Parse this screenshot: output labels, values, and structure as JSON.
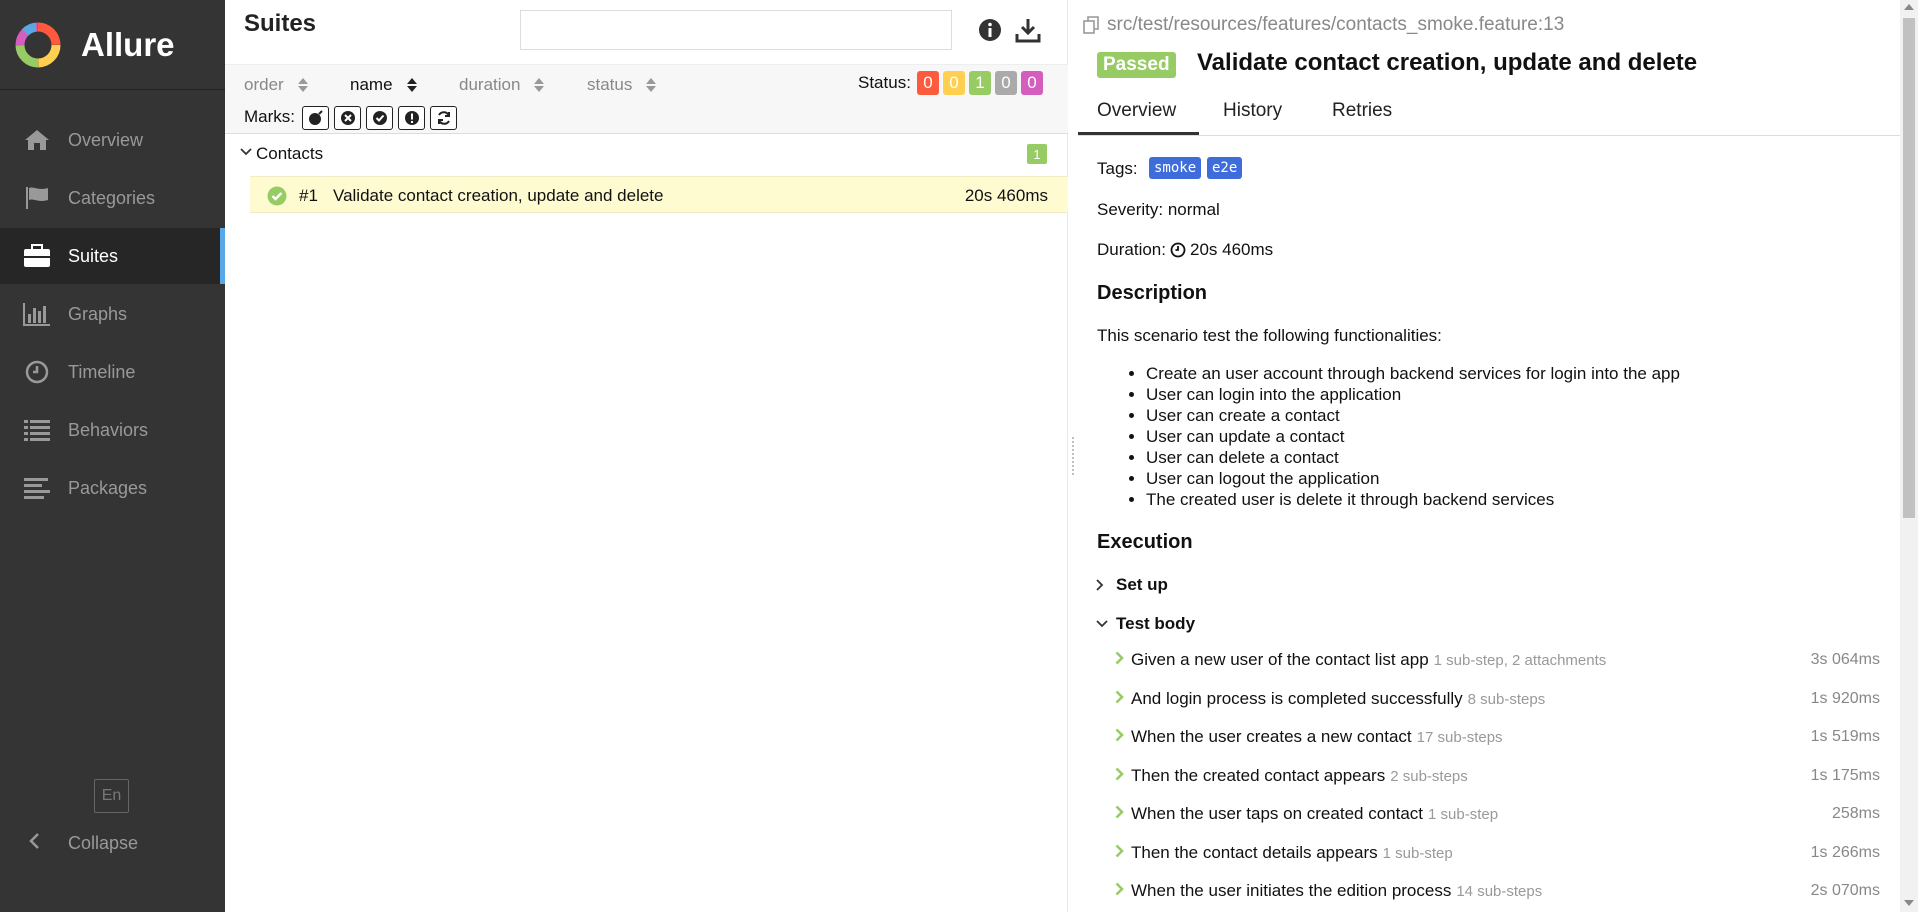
{
  "app": {
    "name": "Allure"
  },
  "sidebar": {
    "items": [
      {
        "label": "Overview",
        "icon": "home-icon"
      },
      {
        "label": "Categories",
        "icon": "flag-icon"
      },
      {
        "label": "Suites",
        "icon": "briefcase-icon",
        "active": true
      },
      {
        "label": "Graphs",
        "icon": "bar-chart-icon"
      },
      {
        "label": "Timeline",
        "icon": "clock-icon"
      },
      {
        "label": "Behaviors",
        "icon": "list-icon"
      },
      {
        "label": "Packages",
        "icon": "align-left-icon"
      }
    ],
    "language": "En",
    "collapse_label": "Collapse"
  },
  "suites": {
    "title": "Suites",
    "search": {
      "value": "",
      "placeholder": ""
    },
    "sorters": [
      "order",
      "name",
      "duration",
      "status"
    ],
    "active_sorter": "name",
    "status_label": "Status:",
    "status_counts": [
      {
        "value": "0",
        "color": "#fd5a3e"
      },
      {
        "value": "0",
        "color": "#ffd050"
      },
      {
        "value": "1",
        "color": "#97cc64"
      },
      {
        "value": "0",
        "color": "#aaaaaa"
      },
      {
        "value": "0",
        "color": "#d35ebe"
      }
    ],
    "marks_label": "Marks:",
    "group": {
      "name": "Contacts",
      "count": "1"
    },
    "test": {
      "order": "#1",
      "name": "Validate contact creation, update and delete",
      "duration": "20s 460ms"
    }
  },
  "detail": {
    "file_path": "src/test/resources/features/contacts_smoke.feature:13",
    "status_badge": "Passed",
    "title": "Validate contact creation, update and delete",
    "tabs": [
      "Overview",
      "History",
      "Retries"
    ],
    "tags_label": "Tags:",
    "tags": [
      "smoke",
      "e2e"
    ],
    "severity": "Severity: normal",
    "duration_label": "Duration:",
    "duration_value": "20s 460ms",
    "description_title": "Description",
    "description_text": "This scenario test the following functionalities:",
    "description_items": [
      "Create an user account through backend services for login into the app",
      "User can login into the application",
      "User can create a contact",
      "User can update a contact",
      "User can delete a contact",
      "User can logout the application",
      "The created user is delete it through backend services"
    ],
    "execution_title": "Execution",
    "setup_label": "Set up",
    "test_body_label": "Test body",
    "steps": [
      {
        "name": "Given a new user of the contact list app",
        "meta": "1 sub-step, 2 attachments",
        "time": "3s 064ms"
      },
      {
        "name": "And login process is completed successfully",
        "meta": "8 sub-steps",
        "time": "1s 920ms"
      },
      {
        "name": "When the user creates a new contact",
        "meta": "17 sub-steps",
        "time": "1s 519ms"
      },
      {
        "name": "Then the created contact appears",
        "meta": "2 sub-steps",
        "time": "1s 175ms"
      },
      {
        "name": "When the user taps on created contact",
        "meta": "1 sub-step",
        "time": "258ms"
      },
      {
        "name": "Then the contact details appears",
        "meta": "1 sub-step",
        "time": "1s 266ms"
      },
      {
        "name": "When the user initiates the edition process",
        "meta": "14 sub-steps",
        "time": "2s 070ms"
      }
    ]
  }
}
